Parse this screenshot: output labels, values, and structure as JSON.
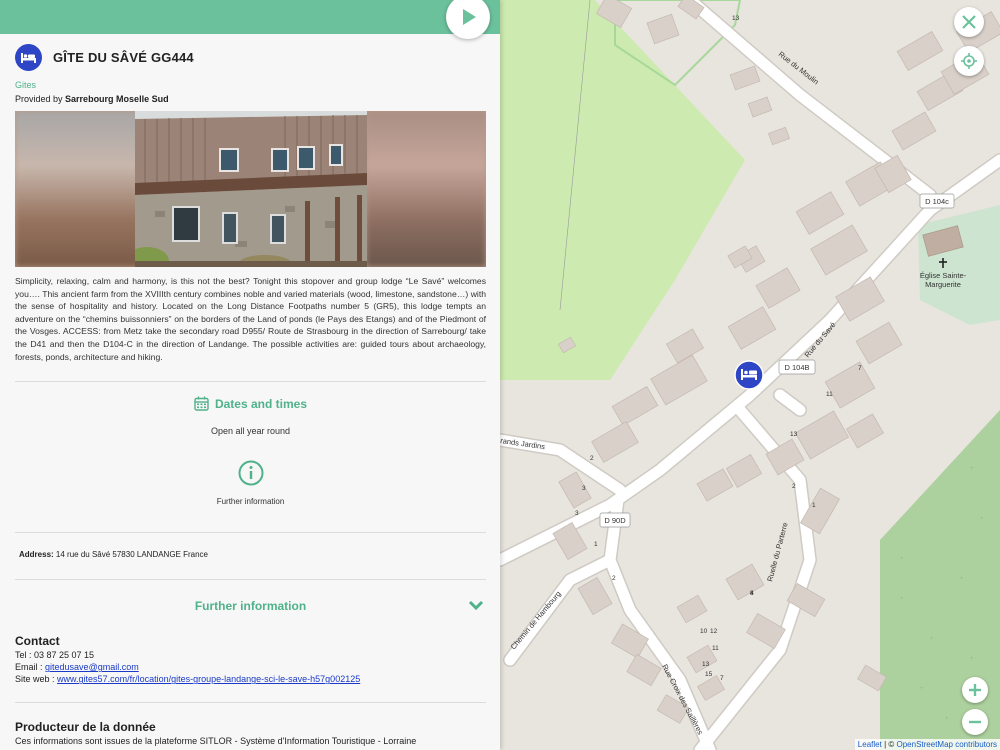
{
  "listing": {
    "title": "GÎTE DU SÂVÉ GG444",
    "category": "Gites",
    "provider_prefix": "Provided by",
    "provider_name": "Sarrebourg Moselle Sud",
    "description": "Simplicity, relaxing, calm and harmony, is this not the best? Tonight this stopover and group lodge “Le Savé” welcomes you…. This ancient farm from the XVIIIth century combines noble and varied materials (wood, limestone, sandstone…) with the sense of hospitality and history. Located on the Long Distance Footpaths number 5 (GR5), this lodge tempts an adventure on the “chemins buissonniers” on the borders of the Land of ponds (le Pays des Etangs) and of the Piedmont of the Vosges. ACCESS: from Metz take the secondary road D955/ Route de Strasbourg in the direction of Sarrebourg/ take the D41 and then the D104-C in the direction of Landange. The possible activities are: guided tours about archaeology, forests, ponds, architecture and hiking.",
    "dates_title": "Dates and times",
    "dates_value": "Open all year round",
    "further_info_label": "Further information",
    "address_label": "Address:",
    "address_value": "14 rue du Sâvé 57830 LANDANGE France",
    "further_section_title": "Further information",
    "contact_title": "Contact",
    "tel_label": "Tel : 03 87 25 07 15",
    "email_prefix": "Email :",
    "email": "gitedusave@gmail.com",
    "web_prefix": "Site web :",
    "website": "www.gites57.com/fr/location/gites-groupe-landange-sci-le-save-h57g002125",
    "producer_title": "Producteur de la donnée",
    "producer_text": "Ces informations sont issues de la plateforme SITLOR - Système d'Information Touristique - Lorraine"
  },
  "map": {
    "labels": {
      "rue_du_moulin": "Rue du Moulin",
      "d104c": "D 104c",
      "church": "Église Sainte-Marguerite",
      "rue_du_save": "Rue du Savé",
      "d104b": "D 104B",
      "grands_jardins": "rands Jardins",
      "d90d": "D 90D",
      "chemin_hambourg": "Chemin de Hambourg",
      "ruelle_parterre": "Ruelle du Parterre",
      "rue_croix": "Rue Croix des Saillères"
    },
    "house_numbers": [
      "13",
      "7",
      "11",
      "13",
      "2",
      "3",
      "1",
      "2",
      "2",
      "1",
      "4",
      "10",
      "12",
      "11",
      "13",
      "15",
      "7",
      "3",
      "8"
    ],
    "attribution_leaflet": "Leaflet",
    "attribution_sep": "| ©",
    "attribution_osm": "OpenStreetMap contributors",
    "marker_icon": "bed-icon"
  },
  "icons": {
    "play": "play-icon",
    "close": "close-icon",
    "locate": "locate-icon",
    "zoom_in": "zoom-in-icon",
    "zoom_out": "zoom-out-icon",
    "calendar": "calendar-icon",
    "info": "info-icon",
    "chevron": "chevron-down-icon"
  },
  "colors": {
    "accent": "#6cc19d",
    "accent_text": "#4fb28a",
    "marker": "#2e45c6",
    "link": "#1a3ac7"
  }
}
